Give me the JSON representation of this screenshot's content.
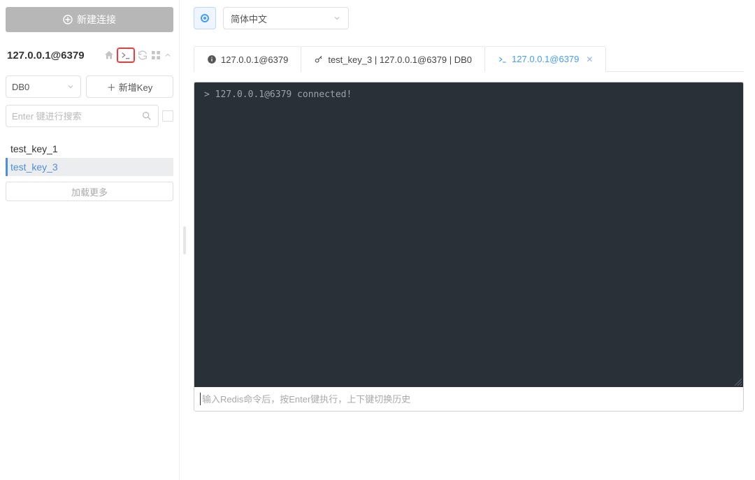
{
  "sidebar": {
    "new_connection_label": "新建连接",
    "connection_title": "127.0.0.1@6379",
    "db_select_label": "DB0",
    "add_key_label": "新增Key",
    "search_placeholder": "Enter 键进行搜索",
    "keys": [
      {
        "name": "test_key_1",
        "selected": false
      },
      {
        "name": "test_key_3",
        "selected": true
      }
    ],
    "load_more_label": "加载更多"
  },
  "header": {
    "language_label": "简体中文"
  },
  "tabs": [
    {
      "icon": "info",
      "label": "127.0.0.1@6379",
      "active": false,
      "closable": false
    },
    {
      "icon": "key",
      "label": "test_key_3 | 127.0.0.1@6379 | DB0",
      "active": false,
      "closable": false
    },
    {
      "icon": "cli",
      "label": "127.0.0.1@6379",
      "active": true,
      "closable": true
    }
  ],
  "terminal": {
    "output": "> 127.0.0.1@6379 connected!",
    "input_placeholder": "输入Redis命令后，按Enter键执行，上下键切换历史"
  }
}
